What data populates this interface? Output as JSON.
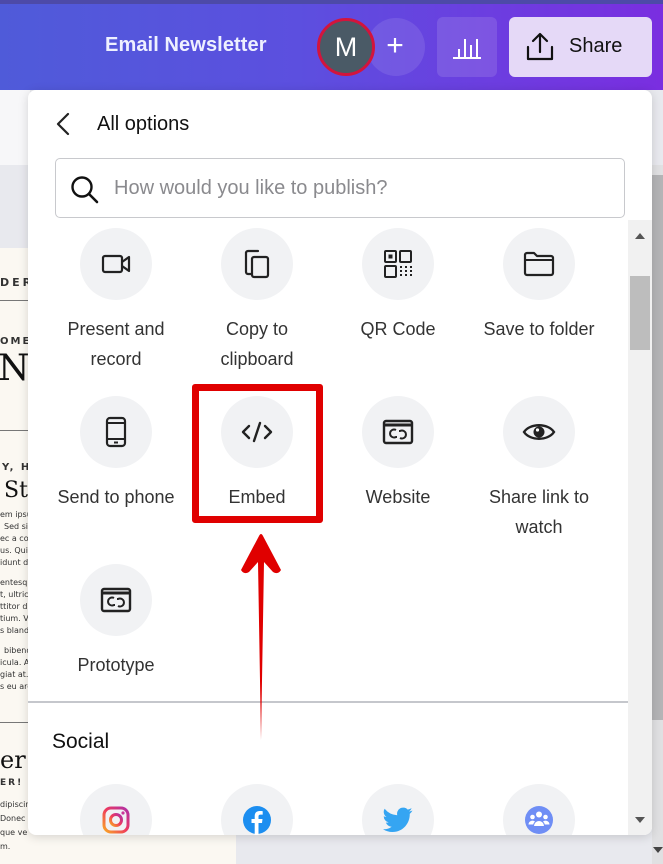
{
  "header": {
    "document_title": "Email Newsletter",
    "avatar_initial": "M",
    "add_collaborator_symbol": "+",
    "insights_icon": "bar-chart-icon",
    "share_label": "Share",
    "share_icon": "upload-icon",
    "colors": {
      "gradient_start": "#4f5bd9",
      "gradient_end": "#7a2ee0",
      "avatar_ring": "#d3143c",
      "share_bg": "#e5d9f7"
    }
  },
  "panel": {
    "back_icon": "chevron-left-icon",
    "title": "All options",
    "search": {
      "placeholder": "How would you like to publish?",
      "value": "",
      "icon": "search-icon"
    },
    "options": [
      {
        "label_line1": "Present and",
        "label_line2": "record",
        "icon": "video-camera-icon"
      },
      {
        "label_line1": "Copy to",
        "label_line2": "clipboard",
        "icon": "copy-icon"
      },
      {
        "label_line1": "QR Code",
        "label_line2": "",
        "icon": "qr-code-icon"
      },
      {
        "label_line1": "Save to folder",
        "label_line2": "",
        "icon": "folder-icon"
      },
      {
        "label_line1": "Send to phone",
        "label_line2": "",
        "icon": "phone-icon"
      },
      {
        "label_line1": "Embed",
        "label_line2": "",
        "icon": "code-icon",
        "highlighted": true
      },
      {
        "label_line1": "Website",
        "label_line2": "",
        "icon": "website-link-icon"
      },
      {
        "label_line1": "Share link to",
        "label_line2": "watch",
        "icon": "eye-icon"
      },
      {
        "label_line1": "Prototype",
        "label_line2": "",
        "icon": "prototype-link-icon"
      }
    ],
    "social": {
      "title": "Social",
      "items": [
        {
          "icon": "instagram-icon"
        },
        {
          "icon": "facebook-icon"
        },
        {
          "icon": "twitter-icon"
        },
        {
          "icon": "group-icon"
        }
      ]
    }
  },
  "annotation": {
    "color": "#e00000",
    "target": "Embed"
  },
  "document_preview": {
    "fragments": [
      "DER",
      "OME T",
      "No",
      "Y, HO",
      "Stu",
      "em ipsu",
      "Sed sit",
      "ec a co",
      "us. Quis",
      "idunt d",
      "entesq",
      "t, ultric",
      "ttitor di",
      "tium. Vi",
      "s bland",
      "bibend",
      "icula. A",
      "giat at.",
      "s eu arc",
      "er M",
      "ER!",
      "dipiscin",
      "Donec",
      "que ve",
      "m."
    ]
  }
}
